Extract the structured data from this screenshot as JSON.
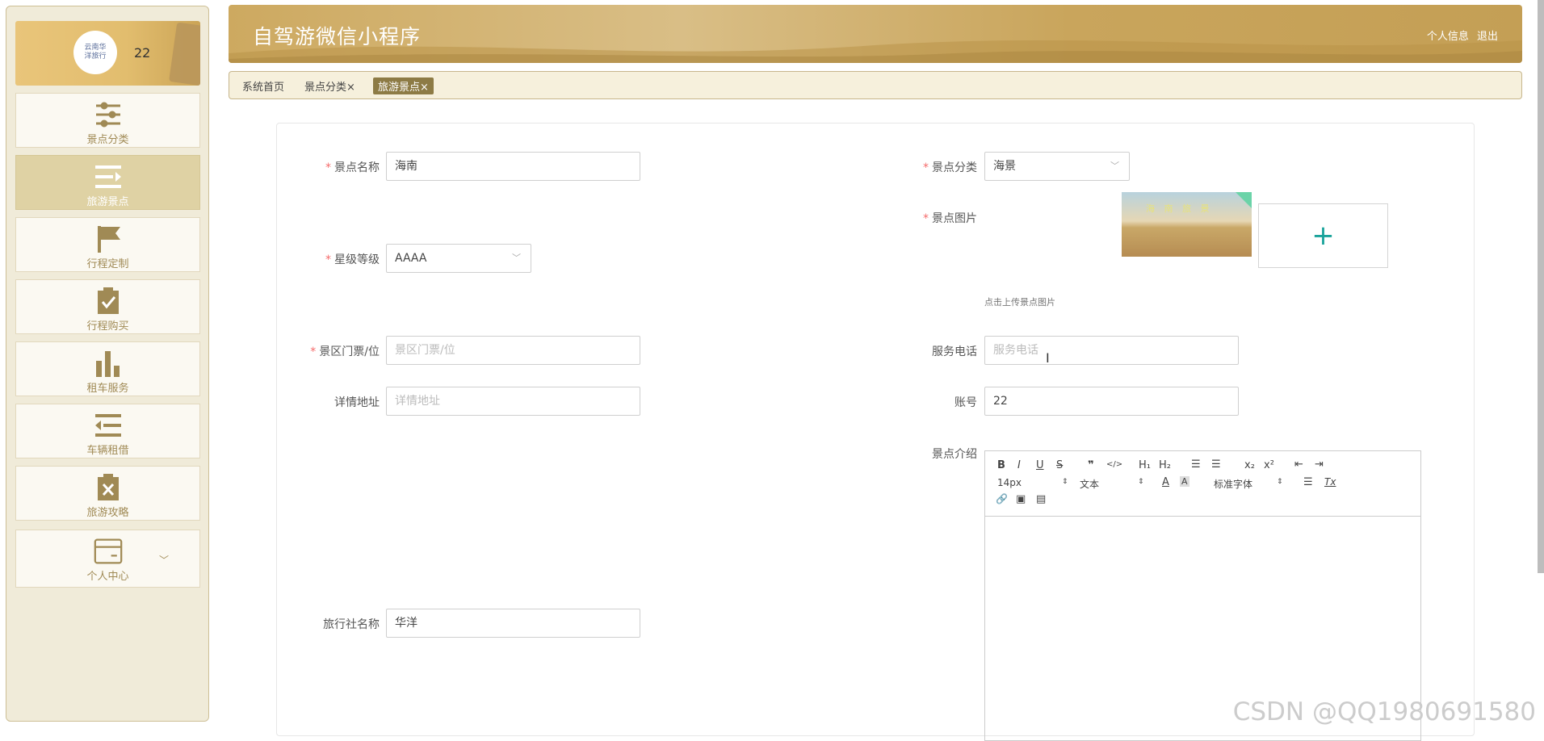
{
  "sidebar": {
    "avatar_text": [
      "云南华",
      "洋旅行"
    ],
    "username": "22",
    "items": [
      {
        "label": "景点分类",
        "icon": "sliders-icon"
      },
      {
        "label": "旅游景点",
        "icon": "list-indent-icon"
      },
      {
        "label": "行程定制",
        "icon": "flag-icon"
      },
      {
        "label": "行程购买",
        "icon": "clipboard-check-icon"
      },
      {
        "label": "租车服务",
        "icon": "bar-chart-icon"
      },
      {
        "label": "车辆租借",
        "icon": "list-outdent-icon"
      },
      {
        "label": "旅游攻略",
        "icon": "clipboard-x-icon"
      },
      {
        "label": "个人中心",
        "icon": "card-icon"
      }
    ]
  },
  "header": {
    "title": "自驾游微信小程序",
    "profile_link": "个人信息",
    "logout_link": "退出"
  },
  "tags": [
    {
      "label": "系统首页"
    },
    {
      "label": "景点分类×"
    },
    {
      "label": "旅游景点×"
    }
  ],
  "form": {
    "name": {
      "label": "景点名称",
      "value": "海南"
    },
    "category": {
      "label": "景点分类",
      "value": "海景"
    },
    "image": {
      "label": "景点图片",
      "hint": "点击上传景点图片",
      "thumb_text": "海 南 旅 景"
    },
    "star": {
      "label": "星级等级",
      "value": "AAAA"
    },
    "ticket": {
      "label": "景区门票/位",
      "placeholder": "景区门票/位"
    },
    "phone": {
      "label": "服务电话",
      "placeholder": "服务电话"
    },
    "address": {
      "label": "详情地址",
      "placeholder": "详情地址"
    },
    "account": {
      "label": "账号",
      "value": "22"
    },
    "intro": {
      "label": "景点介绍"
    },
    "agency": {
      "label": "旅行社名称",
      "value": "华洋"
    }
  },
  "editor": {
    "font_size": "14px",
    "block_type": "文本",
    "font_family": "标准字体",
    "buttons": {
      "bold": "B",
      "italic": "I",
      "underline": "U",
      "strike": "S",
      "quote": "❞",
      "code": "</>",
      "h1": "H₁",
      "h2": "H₂",
      "ol": "☰",
      "ul": "☰",
      "sub": "x₂",
      "sup": "x²",
      "outdent": "⇤",
      "indent": "⇥",
      "color": "A",
      "bg": "A",
      "align": "☰",
      "clean": "Tx",
      "link": "🔗",
      "image": "▣",
      "video": "▤"
    }
  },
  "watermark": "CSDN @QQ1980691580"
}
